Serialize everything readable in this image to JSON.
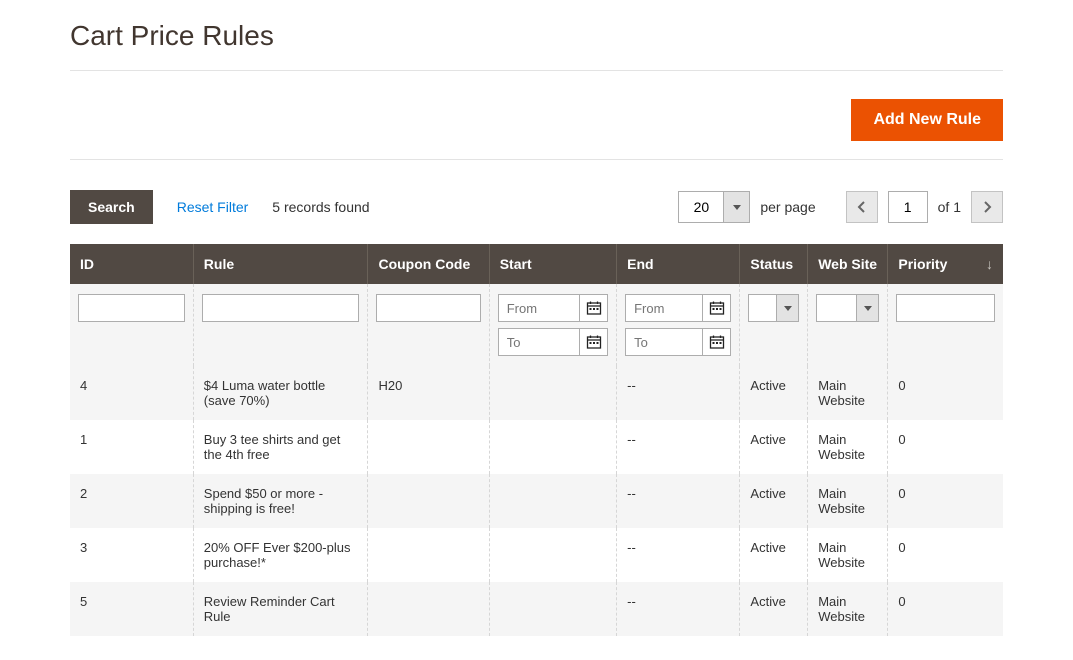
{
  "page": {
    "title": "Cart Price Rules"
  },
  "actions": {
    "add_new_rule": "Add New Rule"
  },
  "toolbar": {
    "search": "Search",
    "reset_filter": "Reset Filter",
    "records_found": "5 records found",
    "per_page_value": "20",
    "per_page_label": "per page",
    "current_page": "1",
    "of_label": "of 1"
  },
  "columns": {
    "id": "ID",
    "rule": "Rule",
    "coupon_code": "Coupon Code",
    "start": "Start",
    "end": "End",
    "status": "Status",
    "web_site": "Web Site",
    "priority": "Priority"
  },
  "filters": {
    "from_placeholder": "From",
    "to_placeholder": "To"
  },
  "rows": [
    {
      "id": "4",
      "rule": "$4 Luma water bottle (save 70%)",
      "coupon": "H20",
      "start": "",
      "end": "--",
      "status": "Active",
      "website": "Main Website",
      "priority": "0"
    },
    {
      "id": "1",
      "rule": "Buy 3 tee shirts and get the 4th free",
      "coupon": "",
      "start": "",
      "end": "--",
      "status": "Active",
      "website": "Main Website",
      "priority": "0"
    },
    {
      "id": "2",
      "rule": "Spend $50 or more - shipping is free!",
      "coupon": "",
      "start": "",
      "end": "--",
      "status": "Active",
      "website": "Main Website",
      "priority": "0"
    },
    {
      "id": "3",
      "rule": "20% OFF Ever $200-plus purchase!*",
      "coupon": "",
      "start": "",
      "end": "--",
      "status": "Active",
      "website": "Main Website",
      "priority": "0"
    },
    {
      "id": "5",
      "rule": "Review Reminder Cart Rule",
      "coupon": "",
      "start": "",
      "end": "--",
      "status": "Active",
      "website": "Main Website",
      "priority": "0"
    }
  ]
}
